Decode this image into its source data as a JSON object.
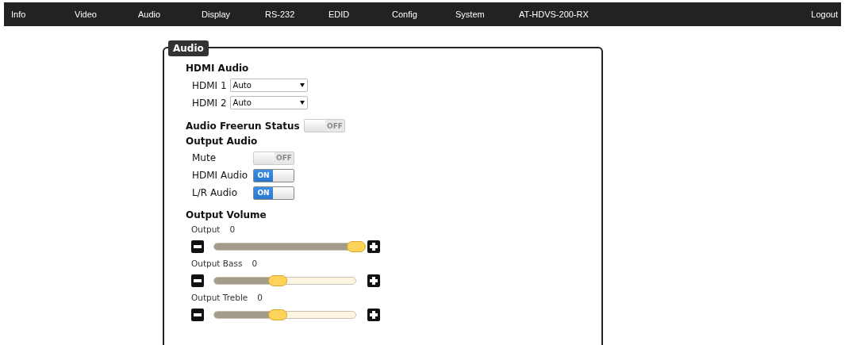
{
  "nav": {
    "items": [
      "Info",
      "Video",
      "Audio",
      "Display",
      "RS-232",
      "EDID",
      "Config",
      "System",
      "AT-HDVS-200-RX"
    ],
    "logout": "Logout"
  },
  "panel": {
    "title": "Audio",
    "hdmi_audio": {
      "heading": "HDMI Audio",
      "inputs": [
        {
          "label": "HDMI 1",
          "value": "Auto"
        },
        {
          "label": "HDMI 2",
          "value": "Auto"
        }
      ]
    },
    "freerun": {
      "label": "Audio Freerun Status",
      "on": false,
      "state_text": "OFF"
    },
    "output_audio": {
      "heading": "Output Audio",
      "switches": [
        {
          "label": "Mute",
          "on": false,
          "state_text": "OFF"
        },
        {
          "label": "HDMI Audio",
          "on": true,
          "state_text": "ON"
        },
        {
          "label": "L/R Audio",
          "on": true,
          "state_text": "ON"
        }
      ]
    },
    "output_volume": {
      "heading": "Output Volume",
      "sliders": [
        {
          "label": "Output",
          "reading": "0",
          "level": 1.0
        },
        {
          "label": "Output Bass",
          "reading": "0",
          "level": 0.45
        },
        {
          "label": "Output Treble",
          "reading": "0",
          "level": 0.45
        }
      ]
    }
  }
}
